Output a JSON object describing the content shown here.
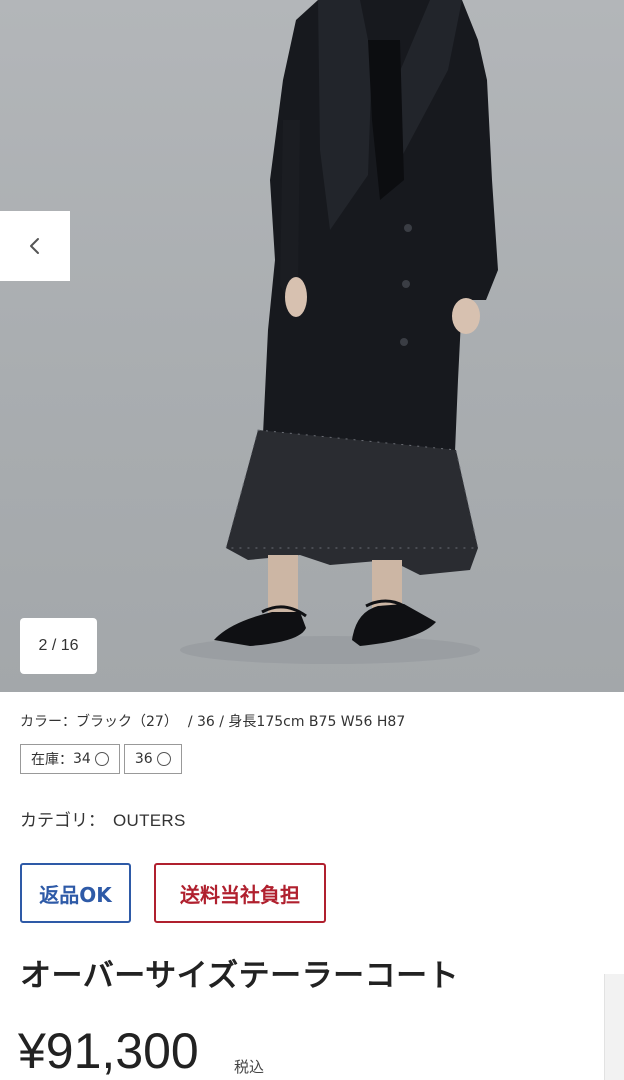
{
  "gallery": {
    "image_icon": "model-photo",
    "prev_icon": "chevron-left-icon",
    "counter": "2 / 16"
  },
  "details": {
    "color_text": "カラー：ブラック（27）",
    "size_text": "/  36  /  身長175cm B75 W56 H87",
    "stock_label": "在庫：",
    "stock_items": [
      "34",
      "36"
    ],
    "category_label": "カテゴリ：",
    "category_value": "OUTERS"
  },
  "badges": {
    "return_label": "返品OK",
    "shipping_label": "送料当社負担",
    "return_color": "#2e5aa7",
    "shipping_color": "#b0202e"
  },
  "product": {
    "title": "オーバーサイズテーラーコート",
    "price": "¥91,300",
    "tax_label": "税込"
  }
}
